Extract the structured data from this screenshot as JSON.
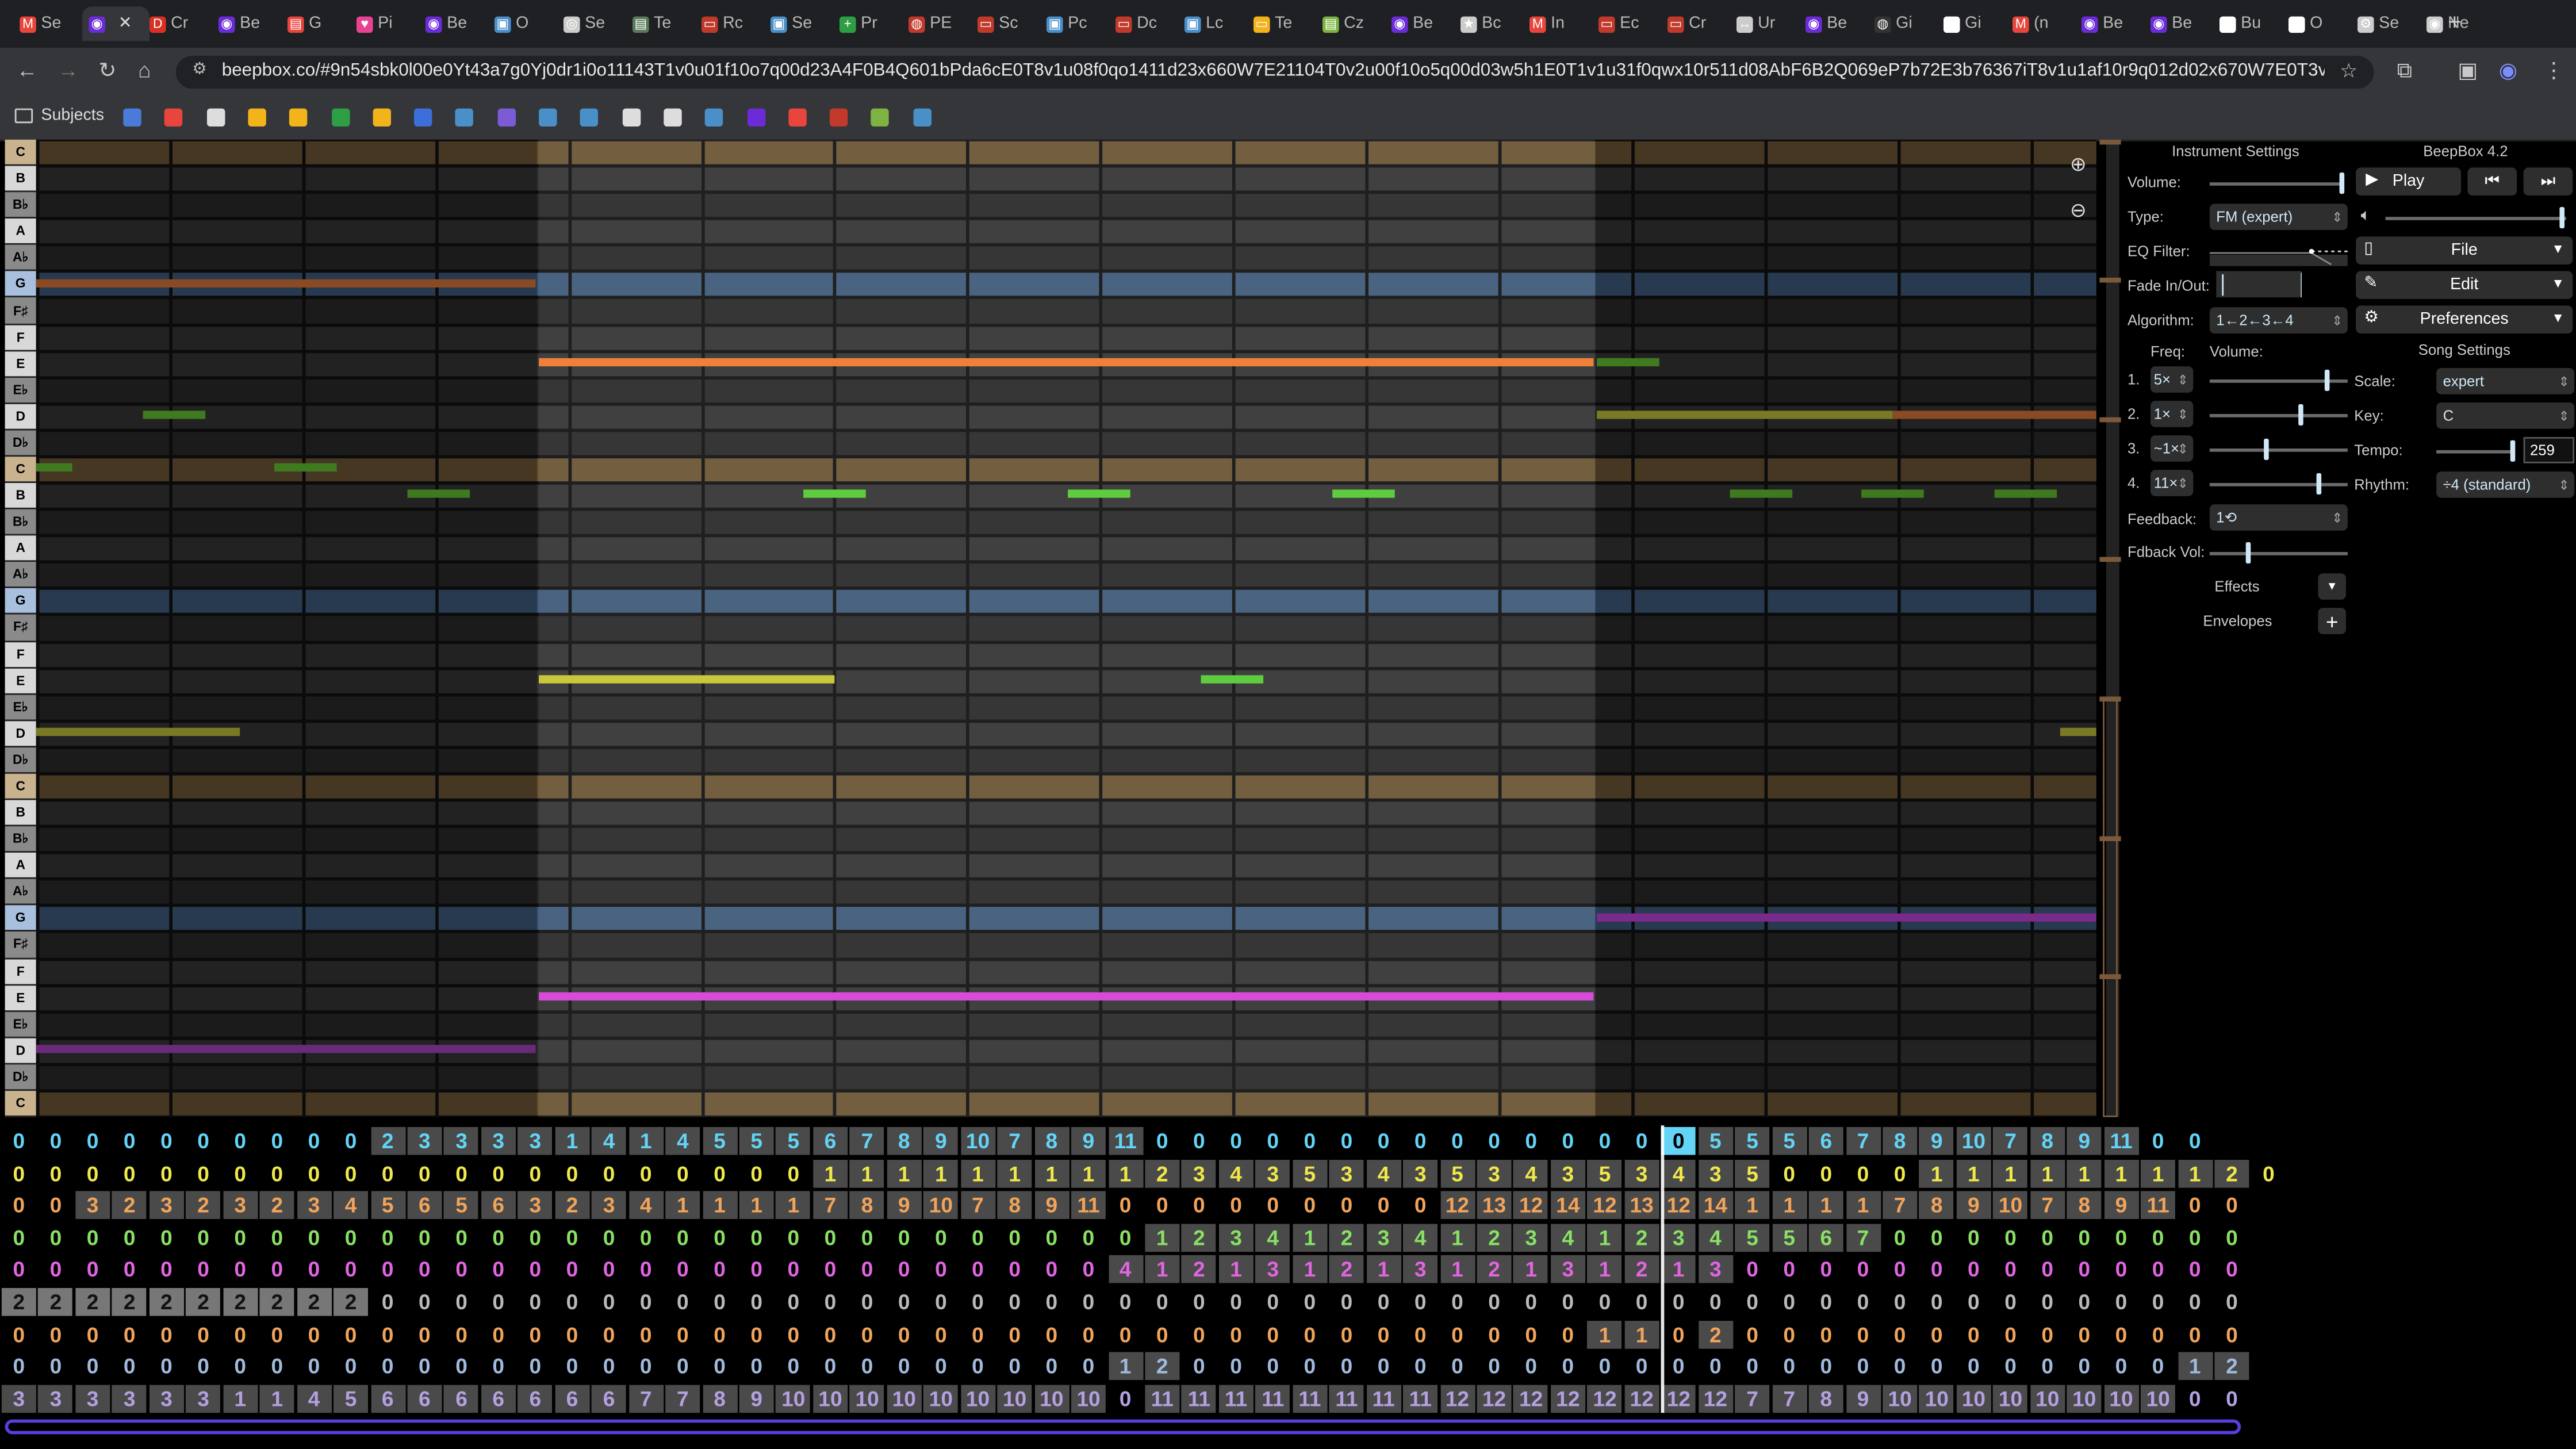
{
  "browser": {
    "tabs": [
      {
        "label": "Se",
        "color": "#e8453c",
        "glyph": "M"
      },
      {
        "label": "",
        "color": "#6b2bd6",
        "glyph": "◉",
        "active": true
      },
      {
        "label": "Cr",
        "color": "#d93025",
        "glyph": "D"
      },
      {
        "label": "Be",
        "color": "#6b2bd6",
        "glyph": "◉"
      },
      {
        "label": "G",
        "color": "#e8453c",
        "glyph": "▤"
      },
      {
        "label": "Pi",
        "color": "#e84393",
        "glyph": "♥"
      },
      {
        "label": "Be",
        "color": "#6b2bd6",
        "glyph": "◉"
      },
      {
        "label": "O",
        "color": "#4a90c8",
        "glyph": "▣"
      },
      {
        "label": "Se",
        "color": "#cccccc",
        "glyph": "◎"
      },
      {
        "label": "Te",
        "color": "#5b7a5b",
        "glyph": "▤"
      },
      {
        "label": "Rc",
        "color": "#c0392b",
        "glyph": "▭"
      },
      {
        "label": "Se",
        "color": "#4a90c8",
        "glyph": "▣"
      },
      {
        "label": "Pr",
        "color": "#2e9e44",
        "glyph": "+"
      },
      {
        "label": "PE",
        "color": "#c0392b",
        "glyph": "◍"
      },
      {
        "label": "Sc",
        "color": "#c0392b",
        "glyph": "▭"
      },
      {
        "label": "Pc",
        "color": "#4a90c8",
        "glyph": "▣"
      },
      {
        "label": "Dc",
        "color": "#c0392b",
        "glyph": "▭"
      },
      {
        "label": "Lc",
        "color": "#4a90c8",
        "glyph": "▣"
      },
      {
        "label": "Te",
        "color": "#f2b31b",
        "glyph": "▭"
      },
      {
        "label": "Cz",
        "color": "#7cb342",
        "glyph": "▤"
      },
      {
        "label": "Be",
        "color": "#6b2bd6",
        "glyph": "◉"
      },
      {
        "label": "Bc",
        "color": "#cccccc",
        "glyph": "★"
      },
      {
        "label": "In",
        "color": "#e8453c",
        "glyph": "M"
      },
      {
        "label": "Ec",
        "color": "#c0392b",
        "glyph": "▭"
      },
      {
        "label": "Cr",
        "color": "#c0392b",
        "glyph": "▭"
      },
      {
        "label": "Ur",
        "color": "#cccccc",
        "glyph": "↔"
      },
      {
        "label": "Be",
        "color": "#6b2bd6",
        "glyph": "◉"
      },
      {
        "label": "Gi",
        "color": "#333333",
        "glyph": "◍"
      },
      {
        "label": "Gi",
        "color": "#ffffff",
        "glyph": "◍"
      },
      {
        "label": "(n",
        "color": "#e8453c",
        "glyph": "M"
      },
      {
        "label": "Be",
        "color": "#6b2bd6",
        "glyph": "◉"
      },
      {
        "label": "Be",
        "color": "#6b2bd6",
        "glyph": "◉"
      },
      {
        "label": "Bu",
        "color": "#ffffff",
        "glyph": "◍"
      },
      {
        "label": "O",
        "color": "#ffffff",
        "glyph": "◍"
      },
      {
        "label": "Se",
        "color": "#cccccc",
        "glyph": "⚙"
      },
      {
        "label": "Ne",
        "color": "#cccccc",
        "glyph": "◉"
      }
    ],
    "url": "beepbox.co/#9n54sbk0l00e0Yt43a7g0Yj0dr1i0o11143T1v0u01f10o7q00d23A4F0B4Q601bPda6cE0T8v1u08f0qo1411d23x660W7E21104T0v2u00f10o5q00d03w5h1E0T1v1u31f0qwx10r511d08AbF6B2Q069eP7b72E3b76367iT8v1u1af10r9q012d02x670W7E0T3v1uf7f0qwx10m...",
    "bookmarks_folder": "Subjects",
    "bookmark_colors": [
      "#4a7bd8",
      "#e8453c",
      "#dddddd",
      "#f2b31b",
      "#f2b31b",
      "#2e9e44",
      "#f2b31b",
      "#3c6fd8",
      "#4a90c8",
      "#7b5cd6",
      "#4a90c8",
      "#4a90c8",
      "#dddddd",
      "#dddddd",
      "#4a90c8",
      "#6b2bd6",
      "#e8453c",
      "#c0392b",
      "#7cb342",
      "#4a90c8"
    ]
  },
  "piano_keys": [
    "C",
    "B",
    "B♭",
    "A",
    "A♭",
    "G",
    "F♯",
    "F",
    "E",
    "E♭",
    "D",
    "D♭",
    "C",
    "B",
    "B♭",
    "A",
    "A♭",
    "G",
    "F♯",
    "F",
    "E",
    "E♭",
    "D",
    "D♭",
    "C",
    "B",
    "B♭",
    "A",
    "A♭",
    "G",
    "F♯",
    "F",
    "E",
    "E♭",
    "D",
    "D♭",
    "C"
  ],
  "instrument": {
    "heading": "Instrument Settings",
    "volume_label": "Volume:",
    "type_label": "Type:",
    "type_value": "FM (expert)",
    "eq_label": "EQ Filter:",
    "fade_label": "Fade In/Out:",
    "algorithm_label": "Algorithm:",
    "algorithm_value": "1←2←3←4",
    "freq_label": "Freq:",
    "opvol_label": "Volume:",
    "operators": [
      {
        "n": "1.",
        "freq": "5×",
        "level": 0.85
      },
      {
        "n": "2.",
        "freq": "1×",
        "level": 0.65
      },
      {
        "n": "3.",
        "freq": "~1×",
        "level": 0.4
      },
      {
        "n": "4.",
        "freq": "11×",
        "level": 0.78
      }
    ],
    "feedback_label": "Feedback:",
    "feedback_value": "1⟲",
    "fdback_vol_label": "Fdback Vol:",
    "effects_label": "Effects",
    "envelopes_label": "Envelopes",
    "volume_level": 0.97,
    "fdback_level": 0.27
  },
  "song": {
    "version": "BeepBox 4.2",
    "play_label": "Play",
    "file_label": "File",
    "edit_label": "Edit",
    "prefs_label": "Preferences",
    "heading": "Song Settings",
    "scale_label": "Scale:",
    "scale_value": "expert",
    "key_label": "Key:",
    "key_value": "C",
    "tempo_label": "Tempo:",
    "tempo_value": "259",
    "rhythm_label": "Rhythm:",
    "rhythm_value": "÷4 (standard)",
    "master_volume": 0.97,
    "tempo_level": 0.95
  },
  "track_colors": [
    "#63d3f6",
    "#f0e84a",
    "#f0a35a",
    "#88e064",
    "#e065e0",
    "#b9b9b9",
    "#f0a35a",
    "#9fbadc",
    "#b4a0e0"
  ],
  "tracks": [
    [
      "0",
      "0",
      "0",
      "0",
      "0",
      "0",
      "0",
      "0",
      "0",
      "0",
      "2",
      "3",
      "3",
      "3",
      "3",
      "1",
      "4",
      "1",
      "4",
      "5",
      "5",
      "5",
      "6",
      "7",
      "8",
      "9",
      "10",
      "7",
      "8",
      "9",
      "11",
      "0",
      "0",
      "0",
      "0",
      "0",
      "0",
      "0",
      "0",
      "0",
      "0",
      "0",
      "0",
      "0",
      "0",
      "0",
      "5",
      "5",
      "5",
      "6",
      "7",
      "8",
      "9",
      "10",
      "7",
      "8",
      "9",
      "11",
      "0",
      "0"
    ],
    [
      "0",
      "0",
      "0",
      "0",
      "0",
      "0",
      "0",
      "0",
      "0",
      "0",
      "0",
      "0",
      "0",
      "0",
      "0",
      "0",
      "0",
      "0",
      "0",
      "0",
      "0",
      "0",
      "1",
      "1",
      "1",
      "1",
      "1",
      "1",
      "1",
      "1",
      "1",
      "2",
      "3",
      "4",
      "3",
      "5",
      "3",
      "4",
      "3",
      "5",
      "3",
      "4",
      "3",
      "5",
      "3",
      "4",
      "3",
      "5",
      "0",
      "0",
      "0",
      "0",
      "1",
      "1",
      "1",
      "1",
      "1",
      "1",
      "1",
      "1",
      "2",
      "0"
    ],
    [
      "0",
      "0",
      "3",
      "2",
      "3",
      "2",
      "3",
      "2",
      "3",
      "4",
      "5",
      "6",
      "5",
      "6",
      "3",
      "2",
      "3",
      "4",
      "1",
      "1",
      "1",
      "1",
      "7",
      "8",
      "9",
      "10",
      "7",
      "8",
      "9",
      "11",
      "0",
      "0",
      "0",
      "0",
      "0",
      "0",
      "0",
      "0",
      "0",
      "12",
      "13",
      "12",
      "14",
      "12",
      "13",
      "12",
      "14",
      "1",
      "1",
      "1",
      "1",
      "7",
      "8",
      "9",
      "10",
      "7",
      "8",
      "9",
      "11",
      "0",
      "0"
    ],
    [
      "0",
      "0",
      "0",
      "0",
      "0",
      "0",
      "0",
      "0",
      "0",
      "0",
      "0",
      "0",
      "0",
      "0",
      "0",
      "0",
      "0",
      "0",
      "0",
      "0",
      "0",
      "0",
      "0",
      "0",
      "0",
      "0",
      "0",
      "0",
      "0",
      "0",
      "0",
      "1",
      "2",
      "3",
      "4",
      "1",
      "2",
      "3",
      "4",
      "1",
      "2",
      "3",
      "4",
      "1",
      "2",
      "3",
      "4",
      "5",
      "5",
      "6",
      "7",
      "0",
      "0",
      "0",
      "0",
      "0",
      "0",
      "0",
      "0",
      "0",
      "0"
    ],
    [
      "0",
      "0",
      "0",
      "0",
      "0",
      "0",
      "0",
      "0",
      "0",
      "0",
      "0",
      "0",
      "0",
      "0",
      "0",
      "0",
      "0",
      "0",
      "0",
      "0",
      "0",
      "0",
      "0",
      "0",
      "0",
      "0",
      "0",
      "0",
      "0",
      "0",
      "4",
      "1",
      "2",
      "1",
      "3",
      "1",
      "2",
      "1",
      "3",
      "1",
      "2",
      "1",
      "3",
      "1",
      "2",
      "1",
      "3",
      "0",
      "0",
      "0",
      "0",
      "0",
      "0",
      "0",
      "0",
      "0",
      "0",
      "0",
      "0",
      "0",
      "0"
    ],
    [
      "2",
      "2",
      "2",
      "2",
      "2",
      "2",
      "2",
      "2",
      "2",
      "2",
      "0",
      "0",
      "0",
      "0",
      "0",
      "0",
      "0",
      "0",
      "0",
      "0",
      "0",
      "0",
      "0",
      "0",
      "0",
      "0",
      "0",
      "0",
      "0",
      "0",
      "0",
      "0",
      "0",
      "0",
      "0",
      "0",
      "0",
      "0",
      "0",
      "0",
      "0",
      "0",
      "0",
      "0",
      "0",
      "0",
      "0",
      "0",
      "0",
      "0",
      "0",
      "0",
      "0",
      "0",
      "0",
      "0",
      "0",
      "0",
      "0",
      "0",
      "0"
    ],
    [
      "0",
      "0",
      "0",
      "0",
      "0",
      "0",
      "0",
      "0",
      "0",
      "0",
      "0",
      "0",
      "0",
      "0",
      "0",
      "0",
      "0",
      "0",
      "0",
      "0",
      "0",
      "0",
      "0",
      "0",
      "0",
      "0",
      "0",
      "0",
      "0",
      "0",
      "0",
      "0",
      "0",
      "0",
      "0",
      "0",
      "0",
      "0",
      "0",
      "0",
      "0",
      "0",
      "0",
      "1",
      "1",
      "0",
      "2",
      "0",
      "0",
      "0",
      "0",
      "0",
      "0",
      "0",
      "0",
      "0",
      "0",
      "0",
      "0",
      "0",
      "0"
    ],
    [
      "0",
      "0",
      "0",
      "0",
      "0",
      "0",
      "0",
      "0",
      "0",
      "0",
      "0",
      "0",
      "0",
      "0",
      "0",
      "0",
      "0",
      "0",
      "0",
      "0",
      "0",
      "0",
      "0",
      "0",
      "0",
      "0",
      "0",
      "0",
      "0",
      "0",
      "1",
      "2",
      "0",
      "0",
      "0",
      "0",
      "0",
      "0",
      "0",
      "0",
      "0",
      "0",
      "0",
      "0",
      "0",
      "0",
      "0",
      "0",
      "0",
      "0",
      "0",
      "0",
      "0",
      "0",
      "0",
      "0",
      "0",
      "0",
      "0",
      "1",
      "2"
    ],
    [
      "3",
      "3",
      "3",
      "3",
      "3",
      "3",
      "1",
      "1",
      "4",
      "5",
      "6",
      "6",
      "6",
      "6",
      "6",
      "6",
      "6",
      "7",
      "7",
      "8",
      "9",
      "10",
      "10",
      "10",
      "10",
      "10",
      "10",
      "10",
      "10",
      "10",
      "0",
      "11",
      "11",
      "11",
      "11",
      "11",
      "11",
      "11",
      "11",
      "12",
      "12",
      "12",
      "12",
      "12",
      "12",
      "12",
      "12",
      "7",
      "7",
      "8",
      "9",
      "10",
      "10",
      "10",
      "10",
      "10",
      "10",
      "10",
      "10",
      "0",
      "0"
    ]
  ]
}
